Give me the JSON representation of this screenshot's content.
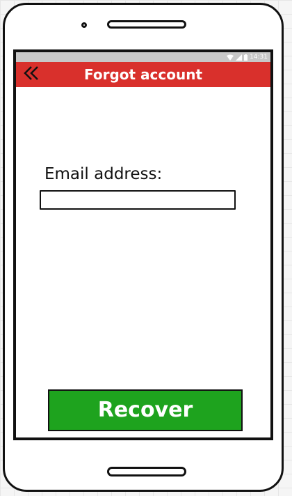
{
  "status_bar": {
    "time": "14:31",
    "icons": [
      "wifi-icon",
      "signal-icon",
      "battery-icon"
    ]
  },
  "app_bar": {
    "title": "Forgot account",
    "back_icon": "double-chevron-left-icon",
    "background_color": "#d9302c"
  },
  "form": {
    "email_label": "Email address:",
    "email_value": "",
    "email_placeholder": ""
  },
  "actions": {
    "recover_label": "Recover",
    "recover_color": "#1ea31e"
  }
}
